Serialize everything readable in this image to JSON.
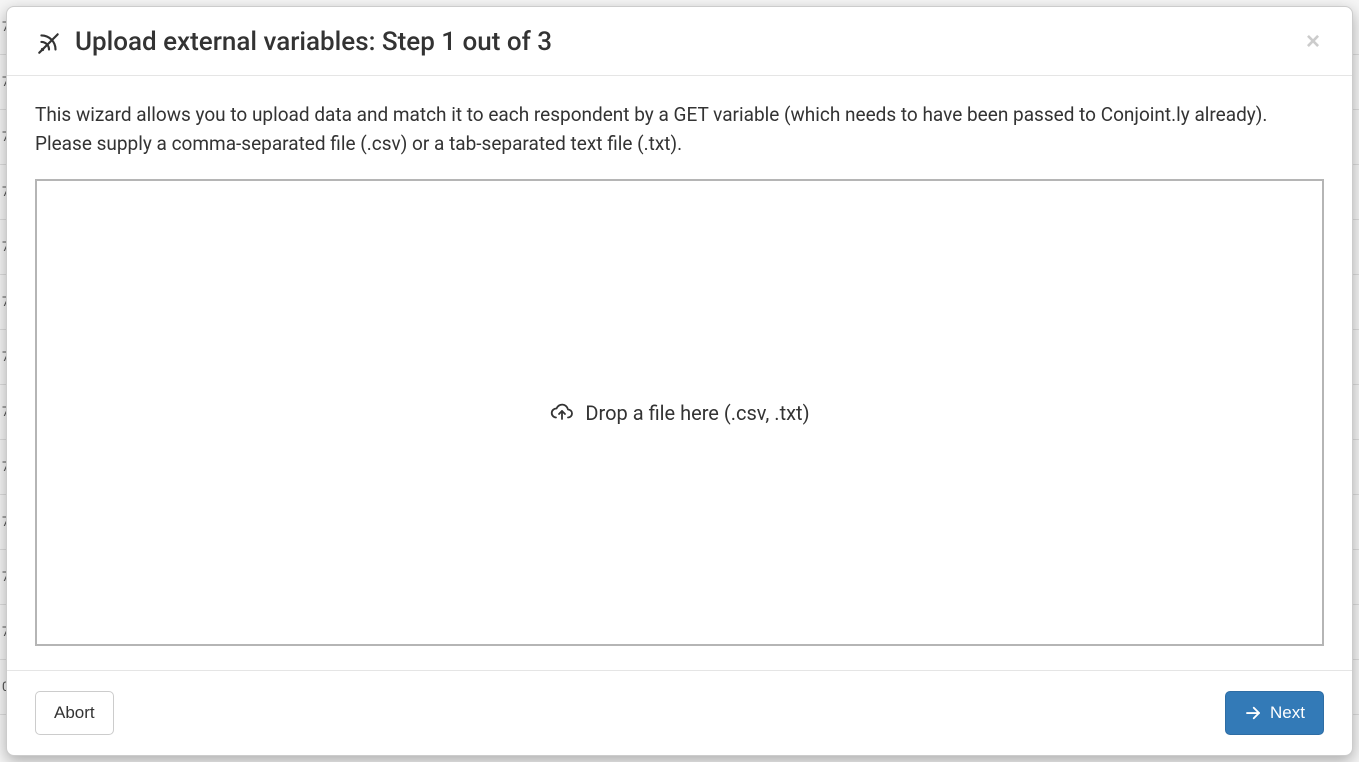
{
  "modal": {
    "title": "Upload external variables: Step 1 out of 3",
    "description": "This wizard allows you to upload data and match it to each respondent by a GET variable (which needs to have been passed to Conjoint.ly already). Please supply a comma-separated file (.csv) or a tab-separated text file (.txt).",
    "dropzone_label": "Drop a file here (.csv, .txt)",
    "abort_label": "Abort",
    "next_label": "Next"
  }
}
